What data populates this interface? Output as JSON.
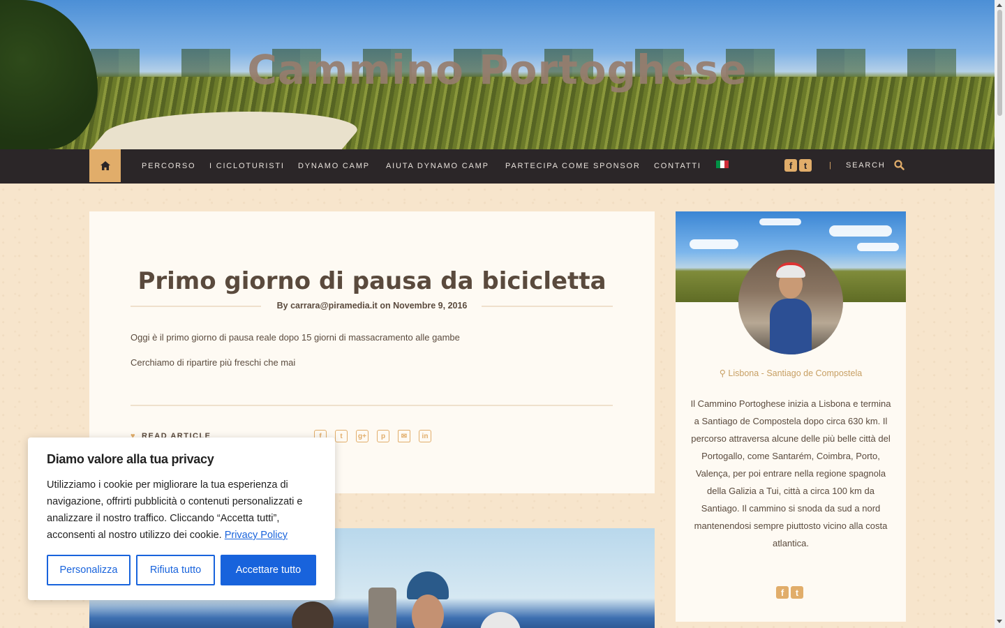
{
  "header": {
    "site_title": "Cammino Portoghese"
  },
  "nav": {
    "items": [
      {
        "label": "PERCORSO"
      },
      {
        "label": "I CICLOTURISTI"
      },
      {
        "label": "DYNAMO CAMP"
      },
      {
        "label": "AIUTA DYNAMO CAMP"
      },
      {
        "label": "PARTECIPA COME SPONSOR"
      },
      {
        "label": "CONTATTI"
      }
    ],
    "separator": "|",
    "search_label": "SEARCH",
    "language_flag_colors": [
      "#009246",
      "#ffffff",
      "#ce2b37"
    ],
    "accent_color": "#e1ad6a",
    "bar_color": "#2b2628"
  },
  "post": {
    "title": "Primo giorno di pausa da bicicletta",
    "byline_prefix": "By",
    "author": "carrara@piramedia.it",
    "byline_on": "on",
    "date": "Novembre 9, 2016",
    "paragraphs": [
      "Oggi è il primo giorno di pausa reale dopo 15 giorni di massacramento alle gambe",
      "Cerchiamo di ripartire più freschi che mai"
    ],
    "read_article": "READ ARTICLE",
    "share_icons": [
      "facebook-icon",
      "twitter-icon",
      "google-plus-icon",
      "pinterest-icon",
      "email-icon",
      "linkedin-icon"
    ]
  },
  "sidebar": {
    "location": "Lisbona - Santiago de Compostela",
    "bio": "Il Cammino Portoghese inizia a Lisbona e termina a Santiago de Compostela dopo circa 630 km. Il percorso attraversa alcune delle più belle città del Portogallo, come Santarém, Coimbra, Porto, Valença, per poi entrare nella regione spagnola della Galizia a Tui, città a circa 100 km da Santiago. Il cammino si snoda da sud a nord mantenendosi sempre piuttosto vicino alla costa atlantica."
  },
  "cookie": {
    "title": "Diamo valore alla tua privacy",
    "text": "Utilizziamo i cookie per migliorare la tua esperienza di navigazione, offrirti pubblicità o contenuti personalizzati e analizzare il nostro traffico. Cliccando “Accetta tutti”, acconsenti al nostro utilizzo dei cookie.",
    "policy_link": "Privacy Policy",
    "buttons": {
      "customize": "Personalizza",
      "reject": "Rifiuta tutto",
      "accept": "Accettare tutto"
    },
    "button_color": "#1863dc"
  }
}
